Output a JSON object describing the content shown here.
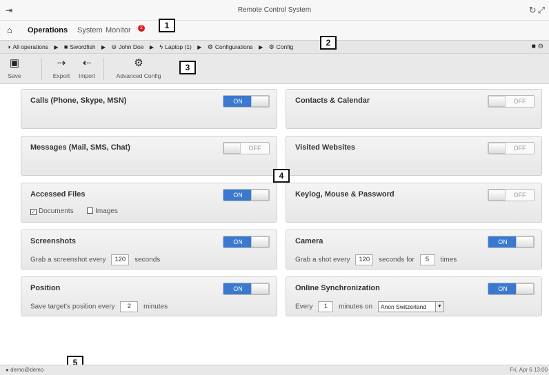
{
  "window": {
    "title": "Remote Control System"
  },
  "nav": {
    "items": [
      "Operations",
      "System",
      "Monitor"
    ],
    "monitor_badge": "2"
  },
  "callouts": [
    "1",
    "2",
    "3",
    "4",
    "5"
  ],
  "breadcrumb": [
    "All operations",
    "Swordfish",
    "John Doe",
    "Laptop (1)",
    "Configurations",
    "Config"
  ],
  "toolbar": {
    "save": "Save",
    "export": "Export",
    "import": "Import",
    "advanced": "Advanced Config"
  },
  "toggle": {
    "on": "ON",
    "off": "OFF"
  },
  "panels": {
    "calls": {
      "title": "Calls (Phone, Skype, MSN)",
      "state": "on"
    },
    "contacts": {
      "title": "Contacts & Calendar",
      "state": "off"
    },
    "messages": {
      "title": "Messages (Mail, SMS, Chat)",
      "state": "off"
    },
    "websites": {
      "title": "Visited Websites",
      "state": "off"
    },
    "files": {
      "title": "Accessed Files",
      "state": "on",
      "documents": "Documents",
      "images": "Images"
    },
    "keylog": {
      "title": "Keylog, Mouse & Password",
      "state": "off"
    },
    "screenshots": {
      "title": "Screenshots",
      "state": "on",
      "prefix": "Grab a screenshot every",
      "value": "120",
      "suffix": "seconds"
    },
    "camera": {
      "title": "Camera",
      "state": "on",
      "prefix": "Grab a shot every",
      "value": "120",
      "middle": "seconds for",
      "times_value": "5",
      "suffix": "times"
    },
    "position": {
      "title": "Position",
      "state": "on",
      "prefix": "Save target's position every",
      "value": "2",
      "suffix": "minutes"
    },
    "sync": {
      "title": "Online Synchronization",
      "state": "on",
      "prefix": "Every",
      "value": "1",
      "middle": "minutes on",
      "server": "Anon Switzerland"
    }
  },
  "status": {
    "user": "demo@demo",
    "time": "Fri, Apr 6  13:00"
  }
}
